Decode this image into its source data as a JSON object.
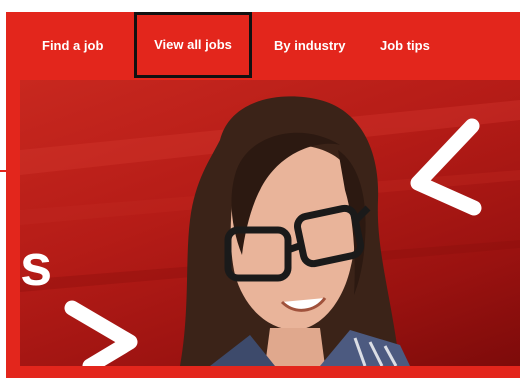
{
  "nav": {
    "items": [
      {
        "label": "Find a job"
      },
      {
        "label": "View all jobs",
        "active": true
      },
      {
        "label": "By industry"
      },
      {
        "label": "Job tips"
      }
    ]
  },
  "hero": {
    "partial_text": "s"
  },
  "colors": {
    "brand_red": "#e3261c",
    "active_outline": "#111111"
  }
}
